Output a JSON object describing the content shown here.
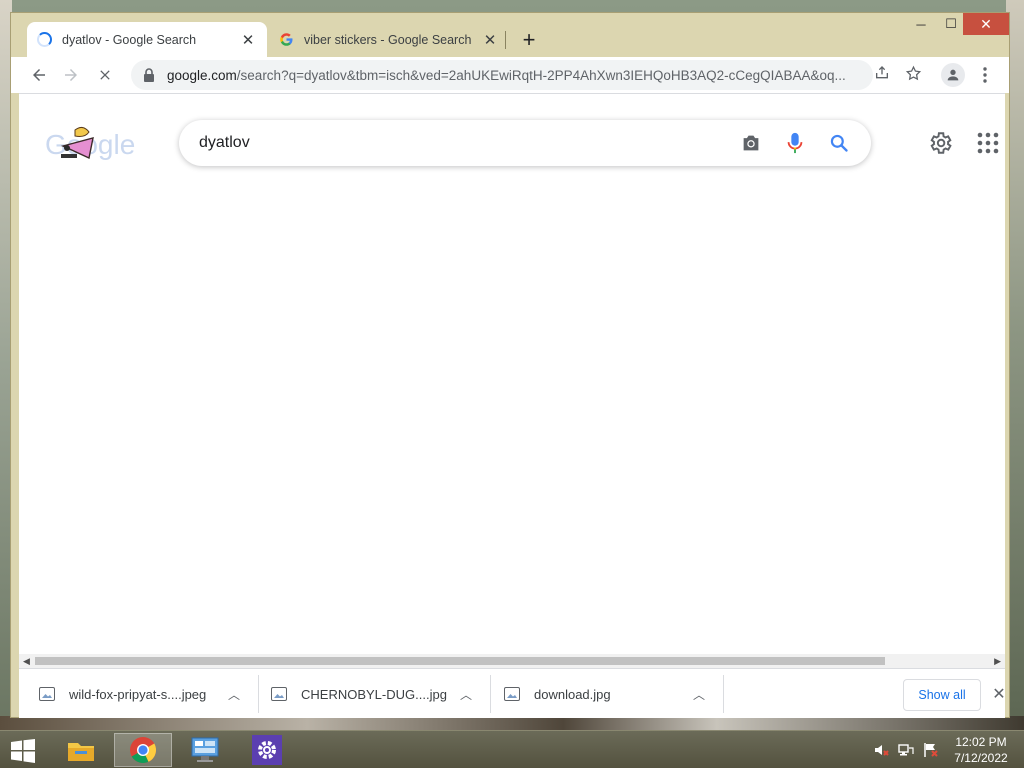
{
  "browser": {
    "tabs": [
      {
        "title": "dyatlov - Google Search",
        "state": "loading",
        "active": true
      },
      {
        "title": "viber stickers - Google Search",
        "state": "loaded",
        "active": false
      }
    ],
    "new_tab_symbol": "+",
    "window_controls": {
      "minimize": "─",
      "maximize": "☐",
      "close": "✕"
    },
    "address_bar": {
      "domain": "google.com",
      "path": "/search?q=dyatlov&tbm=isch&ved=2ahUKEwiRqtH-2PP4AhXwn3IEHQoHB3AQ2-cCegQIABAA&oq..."
    }
  },
  "page": {
    "search_query": "dyatlov",
    "logo_text": "Google",
    "icons": {
      "camera": "camera-icon",
      "mic": "microphone-icon",
      "search": "search-icon",
      "settings": "gear-icon",
      "apps": "apps-grid-icon"
    }
  },
  "downloads": {
    "items": [
      {
        "name": "wild-fox-pripyat-s....jpeg"
      },
      {
        "name": "CHERNOBYL-DUG....jpg"
      },
      {
        "name": "download.jpg"
      }
    ],
    "show_all_label": "Show all",
    "close_symbol": "✕"
  },
  "taskbar": {
    "pinned": [
      "file-explorer-icon",
      "chrome-icon",
      "control-panel-icon",
      "settings-app-icon"
    ],
    "clock": {
      "time": "12:02 PM",
      "date": "7/12/2022"
    }
  },
  "colors": {
    "frame": "#dcd6b0",
    "accent": "#1a73e8",
    "close_button": "#c7503f"
  }
}
